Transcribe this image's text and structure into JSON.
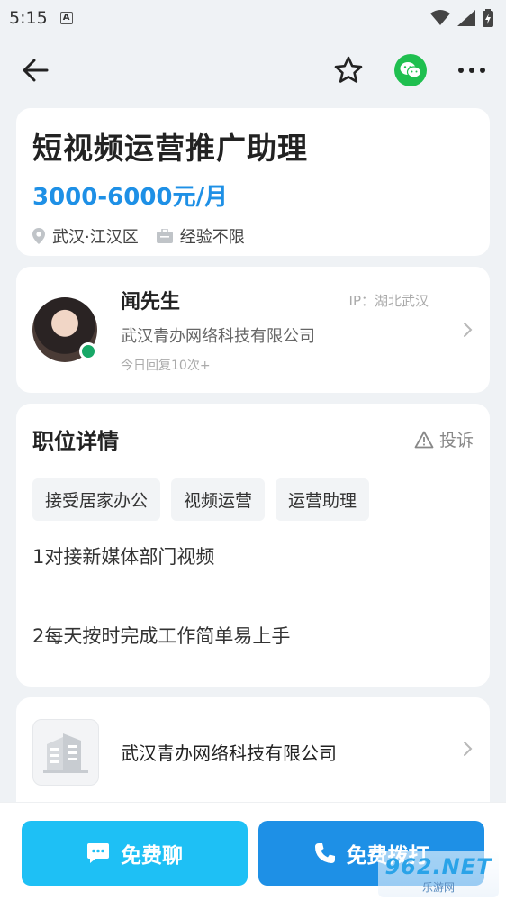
{
  "status_bar": {
    "time": "5:15",
    "notification_letter": "A"
  },
  "nav": {
    "icons": [
      "back-arrow-icon",
      "star-icon",
      "wechat-icon",
      "more-icon"
    ]
  },
  "job": {
    "title": "短视频运营推广助理",
    "salary": "3000-6000元/月",
    "location": "武汉·江汉区",
    "experience": "经验不限"
  },
  "recruiter": {
    "name": "闻先生",
    "ip": "IP：湖北武汉",
    "company": "武汉青办网络科技有限公司",
    "reply": "今日回复10次+"
  },
  "details": {
    "title": "职位详情",
    "report_label": "投诉",
    "tags": [
      "接受居家办公",
      "视频运营",
      "运营助理"
    ],
    "line1": "1对接新媒体部门视频",
    "line2": "2每天按时完成工作简单易上手"
  },
  "company": {
    "name": "武汉青办网络科技有限公司"
  },
  "actions": {
    "chat_label": "免费聊",
    "call_label": "免费拨打"
  },
  "watermark": {
    "main": "962.NET",
    "sub": "乐游网"
  },
  "colors": {
    "salary": "#1e90e6",
    "chat_button": "#1ec0f5",
    "call_button": "#1e90e6",
    "wechat": "#1fbf4f",
    "online": "#18a867"
  }
}
